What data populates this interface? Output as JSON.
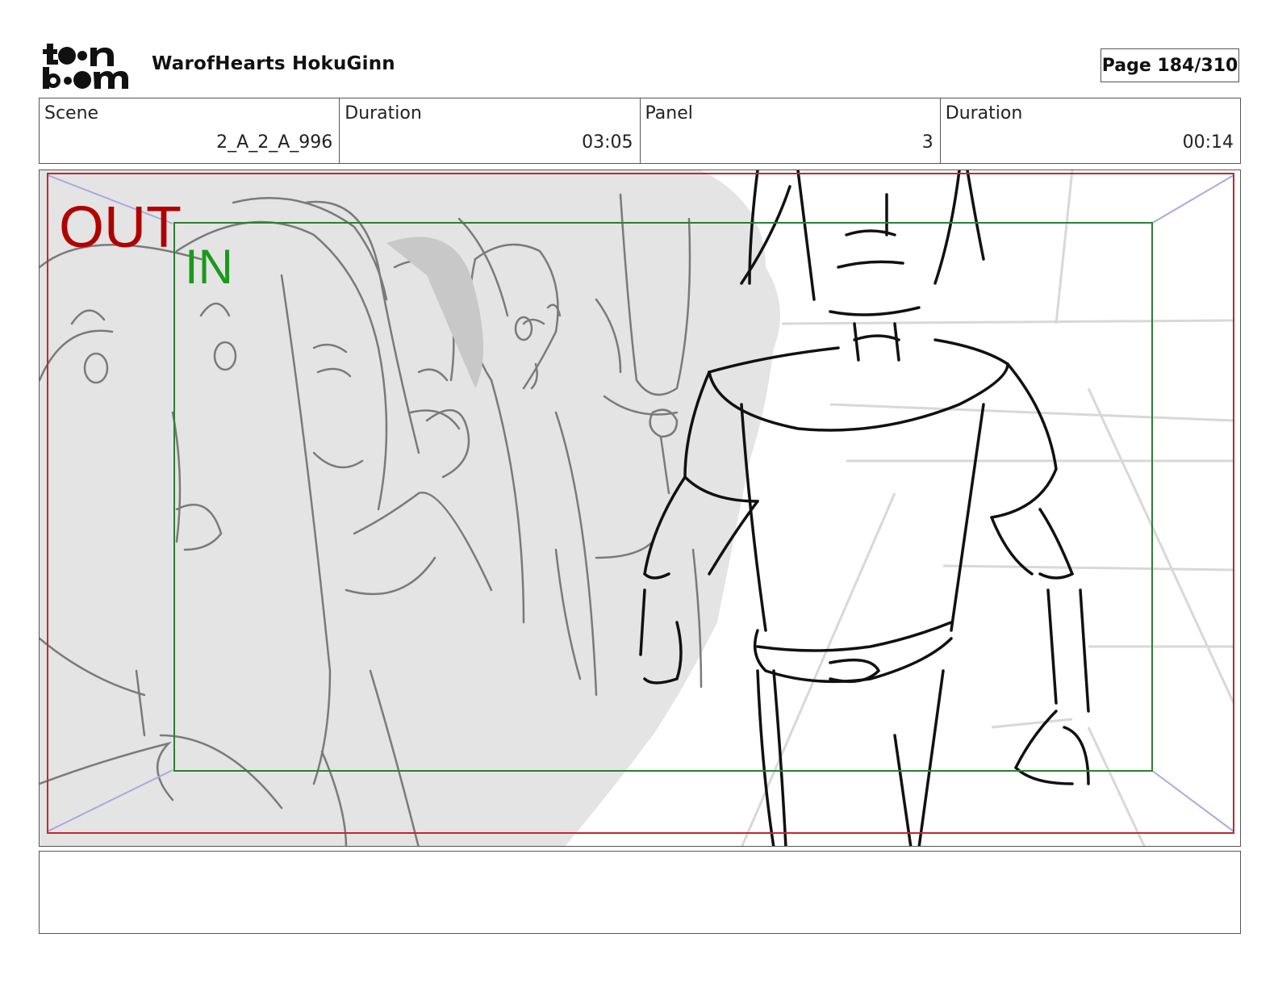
{
  "header": {
    "project_title": "WarofHearts HokuGinn",
    "page_label": "Page",
    "page_value": "184/310"
  },
  "info": {
    "scene_label": "Scene",
    "scene_value": "2_A_2_A_996",
    "scene_duration_label": "Duration",
    "scene_duration_value": "03:05",
    "panel_label": "Panel",
    "panel_value": "3",
    "panel_duration_label": "Duration",
    "panel_duration_value": "00:14"
  },
  "panel": {
    "out_label": "OUT",
    "in_label": "IN",
    "out_color": "#b00000",
    "in_color": "#1a9a1a",
    "out_frame_color": "#c0282e",
    "in_frame_color": "#2e7d32"
  },
  "logo": {
    "line1": "t●●n",
    "line2": "b●●m"
  }
}
